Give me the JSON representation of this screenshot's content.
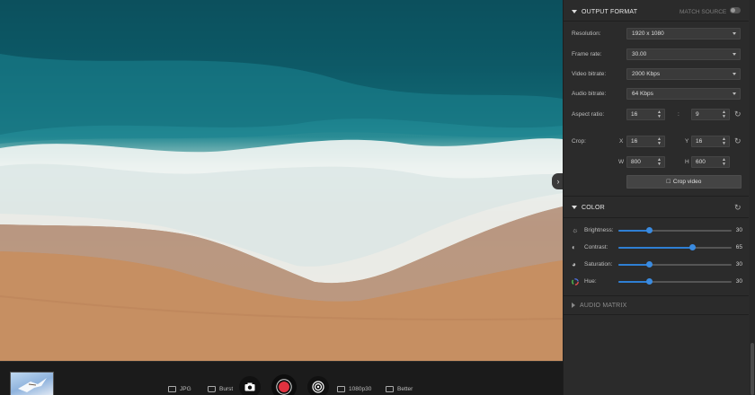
{
  "preview": {
    "description_icon": "chevron-right-icon"
  },
  "bottom_bar": {
    "format_label": "JPG",
    "burst_label": "Burst",
    "resolution_label": "1080p30",
    "quality_label": "Better"
  },
  "output_format": {
    "title": "OUTPUT FORMAT",
    "match_source_label": "MATCH SOURCE",
    "match_source_on": false,
    "resolution_label": "Resolution:",
    "resolution_value": "1920 x 1080",
    "frame_rate_label": "Frame rate:",
    "frame_rate_value": "30.00",
    "video_bitrate_label": "Video bitrate:",
    "video_bitrate_value": "2000 Kbps",
    "audio_bitrate_label": "Audio bitrate:",
    "audio_bitrate_value": "64 Kbps",
    "aspect_ratio_label": "Aspect ratio:",
    "aspect_w": "16",
    "aspect_sep": ":",
    "aspect_h": "9",
    "crop_label": "Crop:",
    "crop_x_label": "X",
    "crop_x": "16",
    "crop_y_label": "Y",
    "crop_y": "16",
    "crop_w_label": "W",
    "crop_w": "800",
    "crop_h_label": "H",
    "crop_h": "600",
    "crop_button_label": "Crop video"
  },
  "color": {
    "title": "COLOR",
    "brightness_label": "Brightness:",
    "brightness_value": "30",
    "brightness_fraction": 0.27,
    "contrast_label": "Contrast:",
    "contrast_value": "65",
    "contrast_fraction": 0.65,
    "saturation_label": "Saturation:",
    "saturation_value": "30",
    "saturation_fraction": 0.27,
    "hue_label": "Hue:",
    "hue_value": "30",
    "hue_fraction": 0.27
  },
  "audio_matrix": {
    "title": "AUDIO MATRIX"
  },
  "colors": {
    "accent": "#2f7fd4",
    "record": "#e0323f",
    "panel_bg": "#2b2b2b"
  }
}
